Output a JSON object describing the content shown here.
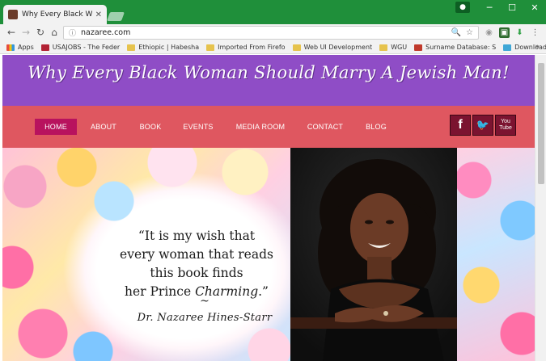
{
  "browser": {
    "tab_title": "Why Every Black Woman",
    "url": "nazaree.com",
    "bookmarks": [
      {
        "label": "Apps",
        "color": "#4a90d9"
      },
      {
        "label": "USAJOBS - The Feder",
        "color": "#b22234"
      },
      {
        "label": "Ethiopic | Habesha",
        "color": "#e6c34d"
      },
      {
        "label": "Imported From Firefo",
        "color": "#e6c34d"
      },
      {
        "label": "Web UI Development",
        "color": "#e6c34d"
      },
      {
        "label": "WGU",
        "color": "#e6c34d"
      },
      {
        "label": "Surname Database: S",
        "color": "#c0392b"
      },
      {
        "label": "Download online vide",
        "color": "#3fa7d6"
      }
    ],
    "more_bookmarks": "»"
  },
  "site": {
    "banner_title": "Why Every Black Woman Should Marry A Jewish Man!",
    "nav": [
      "HOME",
      "ABOUT",
      "BOOK",
      "EVENTS",
      "MEDIA ROOM",
      "CONTACT",
      "BLOG"
    ],
    "active_nav": "HOME",
    "social": {
      "facebook": "f",
      "twitter": "🐦",
      "youtube_top": "You",
      "youtube_bottom": "Tube"
    },
    "colors": {
      "banner": "#8f4dc6",
      "navbar": "#df5760",
      "active_nav": "#b8125e",
      "social": "#7b1330"
    }
  },
  "hero": {
    "quote_line1": "“It is my wish that",
    "quote_line2": "every woman that reads",
    "quote_line3": "this book finds",
    "quote_line4_prefix": "her Prince ",
    "quote_line4_emph": "Charming",
    "quote_line4_suffix": ".”",
    "tilde": "~",
    "author": "Dr. Nazaree Hines-Starr"
  }
}
